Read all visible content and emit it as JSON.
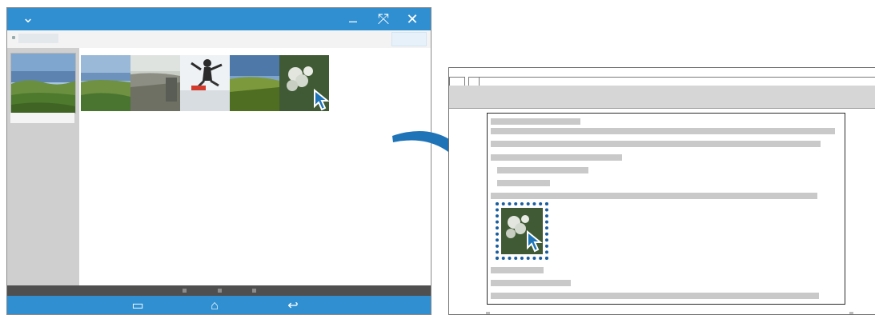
{
  "left_window": {
    "titlebar": {
      "collapse_icon": "chevron-down-icon",
      "minimize_icon": "minimize-icon",
      "expand_icon": "expand-icon",
      "close_icon": "close-icon",
      "collapse_glyph": "⌄",
      "minimize_glyph": "–",
      "expand_glyph": "⤧",
      "close_glyph": "✕"
    },
    "gallery": {
      "photos": [
        "lake-landscape",
        "town-overlook",
        "jumping-person",
        "grass-field",
        "white-flowers"
      ],
      "dragged_photo": "white-flowers"
    },
    "navbar": {
      "recent_apps_glyph": "▭",
      "home_glyph": "⌂",
      "back_glyph": "↩"
    }
  },
  "right_window": {
    "document_lines": 12,
    "dropped_image": "white-flowers"
  },
  "colors": {
    "accent": "#2f8fd1",
    "drop_frame": "#1a5e9e",
    "arrow": "#1f74b8",
    "text_placeholder": "#c9c9c9"
  }
}
